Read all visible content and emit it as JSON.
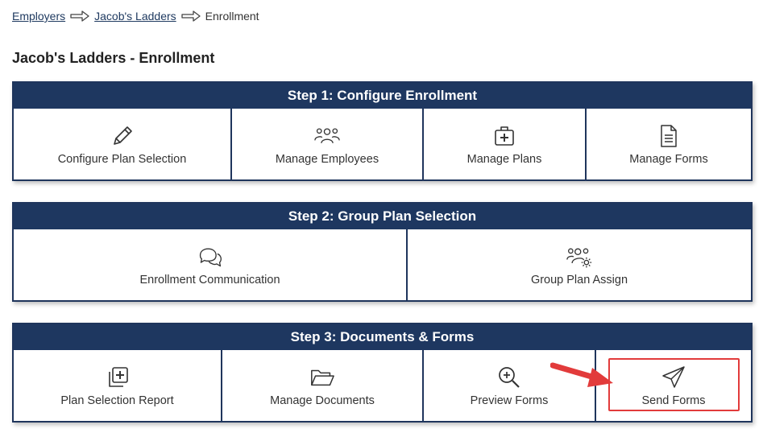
{
  "breadcrumb": {
    "items": [
      {
        "label": "Employers"
      },
      {
        "label": "Jacob's Ladders"
      }
    ],
    "current": "Enrollment"
  },
  "page": {
    "title": "Jacob's Ladders - Enrollment"
  },
  "steps": [
    {
      "title": "Step 1: Configure Enrollment",
      "tiles": [
        {
          "label": "Configure Plan Selection",
          "icon": "pencil-icon"
        },
        {
          "label": "Manage Employees",
          "icon": "users-icon"
        },
        {
          "label": "Manage Plans",
          "icon": "medical-kit-icon"
        },
        {
          "label": "Manage Forms",
          "icon": "document-icon"
        }
      ]
    },
    {
      "title": "Step 2: Group Plan Selection",
      "tiles": [
        {
          "label": "Enrollment Communication",
          "icon": "chat-bubbles-icon"
        },
        {
          "label": "Group Plan Assign",
          "icon": "users-gear-icon"
        }
      ]
    },
    {
      "title": "Step 3: Documents & Forms",
      "tiles": [
        {
          "label": "Plan Selection Report",
          "icon": "copy-plus-icon"
        },
        {
          "label": "Manage Documents",
          "icon": "folder-open-icon"
        },
        {
          "label": "Preview Forms",
          "icon": "zoom-in-icon"
        },
        {
          "label": "Send Forms",
          "icon": "paper-plane-icon"
        }
      ]
    }
  ],
  "colors": {
    "header_bg": "#1e3760",
    "border": "#1f355c",
    "link": "#1f3a60",
    "highlight": "#e23b3b"
  }
}
